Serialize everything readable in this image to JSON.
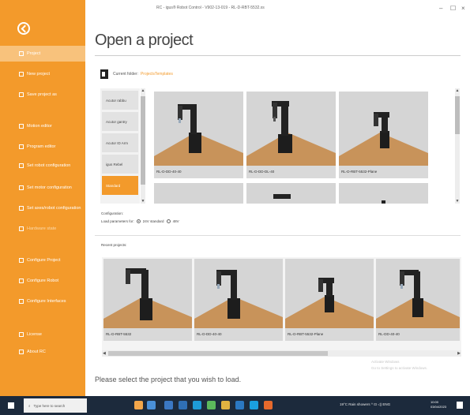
{
  "window": {
    "title": "RC - igus® Robot Control - V902-13-019 - RL-D-RBT-5532.xs",
    "controls": [
      "–",
      "☐",
      "×"
    ]
  },
  "sidebar": {
    "items": [
      {
        "label": "Project",
        "icon": "folder-icon"
      },
      {
        "label": "New project",
        "icon": "new-file-icon"
      },
      {
        "label": "Save project as",
        "icon": "save-icon"
      },
      {
        "label": "Motion editor",
        "icon": "motion-icon"
      },
      {
        "label": "Program editor",
        "icon": "program-icon"
      },
      {
        "label": "Set robot configuration",
        "icon": "robot-icon"
      },
      {
        "label": "Set motor configuration",
        "icon": "motor-icon"
      },
      {
        "label": "Set axes/robot configuration",
        "icon": "axes-icon"
      },
      {
        "label": "Hardware state",
        "icon": "hardware-icon"
      },
      {
        "label": "Configure Project",
        "icon": "settings-icon"
      },
      {
        "label": "Configure Robot",
        "icon": "settings-icon"
      },
      {
        "label": "Configure Interfaces",
        "icon": "settings-icon"
      },
      {
        "label": "License",
        "icon": "license-icon"
      },
      {
        "label": "About RC",
        "icon": "info-icon"
      }
    ]
  },
  "header": {
    "title": "Open a project",
    "current_folder_label": "Current folder:",
    "current_folder_value": "ProjectsTemplates"
  },
  "categories": [
    "Acutor rabbu",
    "Acutor gantry",
    "Acutor ID Arm",
    "igus Rebel",
    "Standard"
  ],
  "templates": [
    {
      "caption": "RL-D-DD-40-40"
    },
    {
      "caption": "RL-D-DD-DL-40"
    },
    {
      "caption": "RL-D-RBT-5532-Plane"
    }
  ],
  "configuration": {
    "label": "Configuration:",
    "load_label": "Load parameters for:",
    "options": [
      "24V standard",
      "48V"
    ],
    "selected": 0
  },
  "recent": {
    "label": "Recent projects:",
    "items": [
      {
        "caption": "RL-D-RBT-5532"
      },
      {
        "caption": "RL-D-DD-40-40"
      },
      {
        "caption": "RL-D-RBT-5532-Plane"
      },
      {
        "caption": "RL-DD-40-40"
      }
    ]
  },
  "prompt": "Please select the project that you wish to load.",
  "watermark": {
    "line1": "Activate Windows",
    "line2": "Go to Settings to activate Windows."
  },
  "taskbar": {
    "search_placeholder": "Type here to search",
    "tray_text": "19°C  Rain showers  ^  ⊡  ◁)  ENG",
    "time": "10:00",
    "date": "03/04/2023"
  },
  "colors": {
    "accent": "#f39a2b",
    "sidebar_active": "#f8c27c",
    "taskbar": "#1c2a3c",
    "tile_bg": "#d5d5d5",
    "floor": "#c8935a"
  }
}
